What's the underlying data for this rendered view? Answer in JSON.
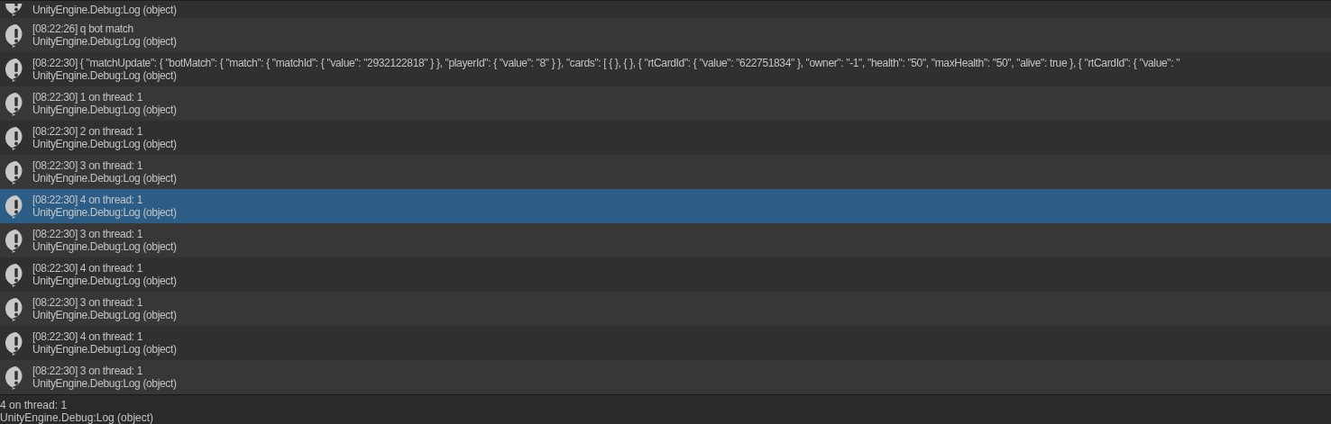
{
  "log_entries": [
    {
      "source": "UnityEngine.Debug:Log (object)",
      "selected": false,
      "partial": true
    },
    {
      "message": "[08:22:26] q bot match",
      "source": "UnityEngine.Debug:Log (object)",
      "selected": false
    },
    {
      "message": "[08:22:30] { \"matchUpdate\": { \"botMatch\": { \"match\": { \"matchId\": { \"value\": \"2932122818\" } }, \"playerId\": { \"value\": \"8\" } }, \"cards\": [ { }, { }, { \"rtCardId\": { \"value\": \"622751834\" }, \"owner\": \"-1\", \"health\": \"50\", \"maxHealth\": \"50\", \"alive\": true }, { \"rtCardId\": { \"value\": \"",
      "source": "UnityEngine.Debug:Log (object)",
      "selected": false
    },
    {
      "message": "[08:22:30] 1 on thread: 1",
      "source": "UnityEngine.Debug:Log (object)",
      "selected": false
    },
    {
      "message": "[08:22:30] 2 on thread: 1",
      "source": "UnityEngine.Debug:Log (object)",
      "selected": false
    },
    {
      "message": "[08:22:30] 3 on thread: 1",
      "source": "UnityEngine.Debug:Log (object)",
      "selected": false
    },
    {
      "message": "[08:22:30] 4 on thread: 1",
      "source": "UnityEngine.Debug:Log (object)",
      "selected": true
    },
    {
      "message": "[08:22:30] 3 on thread: 1",
      "source": "UnityEngine.Debug:Log (object)",
      "selected": false
    },
    {
      "message": "[08:22:30] 4 on thread: 1",
      "source": "UnityEngine.Debug:Log (object)",
      "selected": false
    },
    {
      "message": "[08:22:30] 3 on thread: 1",
      "source": "UnityEngine.Debug:Log (object)",
      "selected": false
    },
    {
      "message": "[08:22:30] 4 on thread: 1",
      "source": "UnityEngine.Debug:Log (object)",
      "selected": false
    },
    {
      "message": "[08:22:30] 3 on thread: 1",
      "source": "UnityEngine.Debug:Log (object)",
      "selected": false
    }
  ],
  "detail": {
    "lines": [
      "4 on thread: 1",
      "UnityEngine.Debug:Log (object)"
    ]
  }
}
